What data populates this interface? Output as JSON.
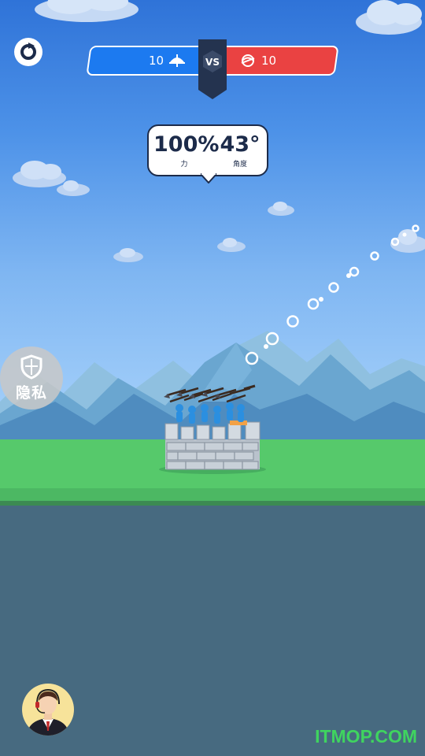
{
  "scoreboard": {
    "blue_count": "10",
    "red_count": "10",
    "vs_label": "VS"
  },
  "aim": {
    "power_value": "100%",
    "power_label": "力",
    "angle_value": "43°",
    "angle_label": "角度"
  },
  "privacy_button": {
    "label": "隐私"
  },
  "watermark": "ITMOP.COM",
  "colors": {
    "blue_team": "#1c7af0",
    "red_team": "#ea4242",
    "grass": "#56c96b",
    "ground": "#476a80"
  }
}
